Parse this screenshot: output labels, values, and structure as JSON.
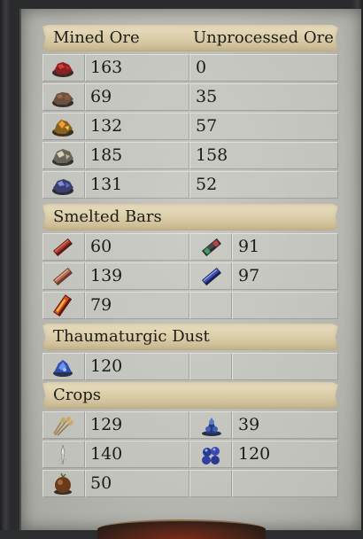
{
  "mined_ore": {
    "header": "Mined Ore",
    "header2": "Unprocessed Ore",
    "rows": [
      {
        "icon": "red-ore-icon",
        "mined": "163",
        "unprocessed": "0"
      },
      {
        "icon": "brown-ore-icon",
        "mined": "69",
        "unprocessed": "35"
      },
      {
        "icon": "gold-ore-icon",
        "mined": "132",
        "unprocessed": "57"
      },
      {
        "icon": "silver-ore-icon",
        "mined": "185",
        "unprocessed": "158"
      },
      {
        "icon": "blue-ore-icon",
        "mined": "131",
        "unprocessed": "52"
      }
    ]
  },
  "smelted_bars": {
    "header": "Smelted Bars",
    "items": [
      {
        "icon": "red-bar-icon",
        "value": "60"
      },
      {
        "icon": "green-bar-icon",
        "value": "91"
      },
      {
        "icon": "copper-bar-icon",
        "value": "139"
      },
      {
        "icon": "blue-bar-icon",
        "value": "97"
      },
      {
        "icon": "fire-bar-icon",
        "value": "79"
      }
    ]
  },
  "dust": {
    "header": "Thaumaturgic Dust",
    "items": [
      {
        "icon": "blue-dust-icon",
        "value": "120"
      }
    ]
  },
  "crops": {
    "header": "Crops",
    "items": [
      {
        "icon": "wheat-icon",
        "value": "129"
      },
      {
        "icon": "blue-flower-icon",
        "value": "39"
      },
      {
        "icon": "white-root-icon",
        "value": "140"
      },
      {
        "icon": "blue-berries-icon",
        "value": "120"
      },
      {
        "icon": "brown-seed-icon",
        "value": "50"
      }
    ]
  }
}
